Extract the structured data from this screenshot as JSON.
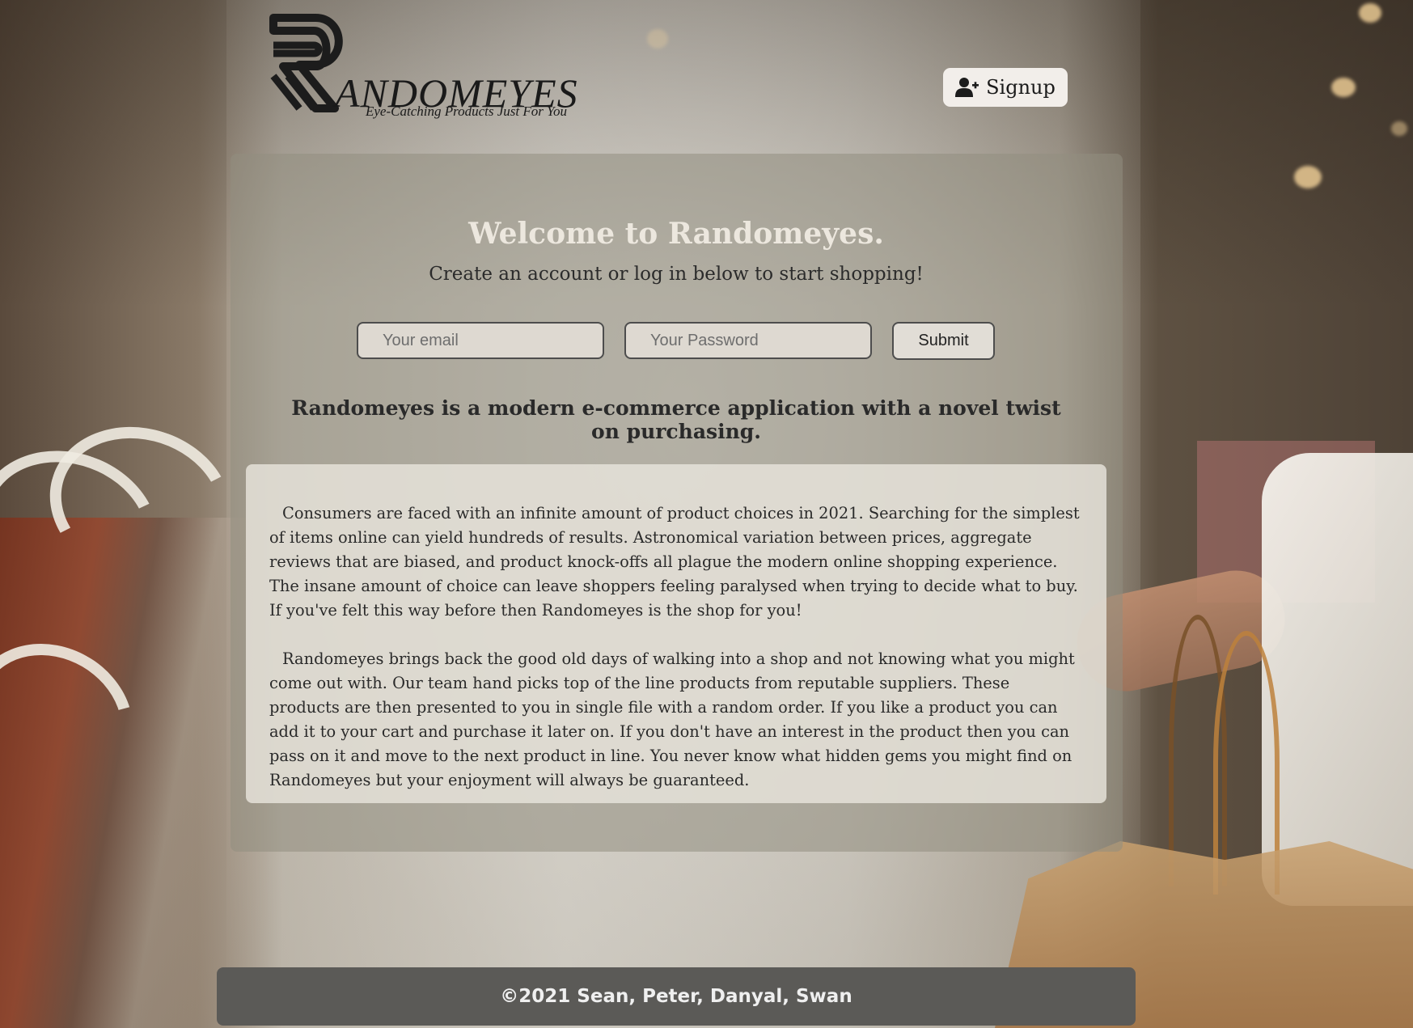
{
  "header": {
    "logo_word": "ANDOMEYES",
    "logo_tagline": "Eye-Catching Products Just For You",
    "signup_label": "Signup",
    "signup_icon": "user-plus-icon"
  },
  "hero": {
    "title": "Welcome to Randomeyes.",
    "subtitle": "Create an account or log in below to start shopping!"
  },
  "login_form": {
    "email_placeholder": "Your email",
    "email_value": "",
    "password_placeholder": "Your Password",
    "password_value": "",
    "submit_label": "Submit"
  },
  "about": {
    "tagline": "Randomeyes is a modern e-commerce application with a novel twist on purchasing.",
    "paragraphs": [
      "Consumers are faced with an infinite amount of product choices in 2021. Searching for the simplest of items online can yield hundreds of results. Astronomical variation between prices, aggregate reviews that are biased, and product knock-offs all plague the modern online shopping experience. The insane amount of choice can leave shoppers feeling paralysed when trying to decide what to buy. If you've felt this way before then Randomeyes is the shop for you!",
      "Randomeyes brings back the good old days of walking into a shop and not knowing what you might come out with. Our team hand picks top of the line products from reputable suppliers. These products are then presented to you in single file with a random order. If you like a product you can add it to your cart and purchase it later on. If you don't have an interest in the product then you can pass on it and move to the next product in line. You never know what hidden gems you might find on Randomeyes but your enjoyment will always be guaranteed."
    ]
  },
  "footer": {
    "copyright": "©2021 Sean, Peter, Danyal, Swan"
  },
  "colors": {
    "panel": "#918e80",
    "footer": "#5b5a57",
    "title": "#ece7de",
    "text": "#2a2a2a"
  }
}
